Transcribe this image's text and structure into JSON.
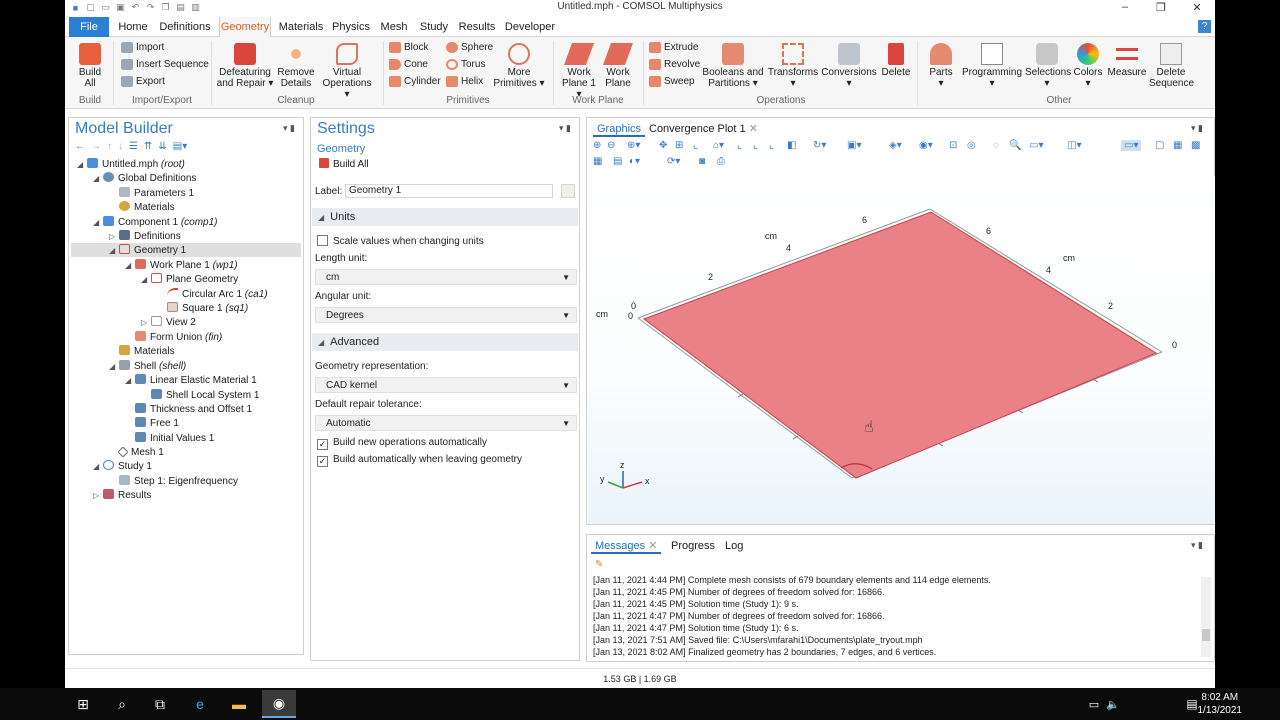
{
  "window": {
    "title": "Untitled.mph - COMSOL Multiphysics",
    "controls": [
      "–",
      "❐",
      "✕"
    ]
  },
  "menu_tabs": [
    "File",
    "Home",
    "Definitions",
    "Geometry",
    "Materials",
    "Physics",
    "Mesh",
    "Study",
    "Results",
    "Developer"
  ],
  "ribbon": {
    "build_all": "Build\nAll",
    "build_group": "Build",
    "import": "Import",
    "insert_sequence": "Insert Sequence",
    "export": "Export",
    "import_export_group": "Import/Export",
    "defeaturing": "Defeaturing\nand Repair ▾",
    "remove_details": "Remove\nDetails",
    "virtual_ops": "Virtual\nOperations ▾",
    "cleanup_group": "Cleanup",
    "block": "Block",
    "cone": "Cone",
    "cylinder": "Cylinder",
    "sphere": "Sphere",
    "torus": "Torus",
    "helix": "Helix",
    "more_primitives": "More\nPrimitives ▾",
    "primitives_group": "Primitives",
    "work_plane": "Work\nPlane 1 ▾",
    "work_plane2": "Work\nPlane",
    "work_plane_group": "Work Plane",
    "extrude": "Extrude",
    "revolve": "Revolve",
    "sweep": "Sweep",
    "booleans": "Booleans and\nPartitions ▾",
    "transforms": "Transforms\n▾",
    "conversions": "Conversions\n▾",
    "delete": "Delete",
    "operations_group": "Operations",
    "parts": "Parts\n▾",
    "programming": "Programming\n▾",
    "selections": "Selections\n▾",
    "colors": "Colors\n▾",
    "measure": "Measure",
    "delete_sequence": "Delete\nSequence",
    "other_group": "Other"
  },
  "model_builder": {
    "title": "Model Builder",
    "tree": [
      {
        "label": "Untitled.mph",
        "tag": "(root)"
      },
      {
        "label": "Global Definitions",
        "tag": ""
      },
      {
        "label": "Parameters 1",
        "tag": ""
      },
      {
        "label": "Materials",
        "tag": ""
      },
      {
        "label": "Component 1",
        "tag": "(comp1)"
      },
      {
        "label": "Definitions",
        "tag": ""
      },
      {
        "label": "Geometry 1",
        "tag": ""
      },
      {
        "label": "Work Plane 1",
        "tag": "(wp1)"
      },
      {
        "label": "Plane Geometry",
        "tag": ""
      },
      {
        "label": "Circular Arc 1",
        "tag": "(ca1)"
      },
      {
        "label": "Square 1",
        "tag": "(sq1)"
      },
      {
        "label": "View 2",
        "tag": ""
      },
      {
        "label": "Form Union",
        "tag": "(fin)"
      },
      {
        "label": "Materials",
        "tag": ""
      },
      {
        "label": "Shell",
        "tag": "(shell)"
      },
      {
        "label": "Linear Elastic Material 1",
        "tag": ""
      },
      {
        "label": "Shell Local System 1",
        "tag": ""
      },
      {
        "label": "Thickness and Offset 1",
        "tag": ""
      },
      {
        "label": "Free 1",
        "tag": ""
      },
      {
        "label": "Initial Values 1",
        "tag": ""
      },
      {
        "label": "Mesh 1",
        "tag": ""
      },
      {
        "label": "Study 1",
        "tag": ""
      },
      {
        "label": "Step 1: Eigenfrequency",
        "tag": ""
      },
      {
        "label": "Results",
        "tag": ""
      }
    ]
  },
  "settings": {
    "title": "Settings",
    "subtitle": "Geometry",
    "build_all": "Build All",
    "label_caption": "Label:",
    "label_value": "Geometry 1",
    "units_section": "Units",
    "scale_values": "Scale values when changing units",
    "length_unit_caption": "Length unit:",
    "length_unit": "cm",
    "angular_unit_caption": "Angular unit:",
    "angular_unit": "Degrees",
    "advanced_section": "Advanced",
    "geom_rep_caption": "Geometry representation:",
    "geom_rep": "CAD kernel",
    "repair_tol_caption": "Default repair tolerance:",
    "repair_tol": "Automatic",
    "build_new_ops": "Build new operations automatically",
    "build_leaving": "Build automatically when leaving geometry"
  },
  "graphics": {
    "tab_graphics": "Graphics",
    "tab_convergence": "Convergence Plot 1",
    "axis_ticks_back_left": [
      "0",
      "2",
      "4",
      "6"
    ],
    "axis_ticks_back_right": [
      "6",
      "4",
      "2",
      "0"
    ],
    "unit_label": "cm",
    "triad": {
      "z": "z",
      "y": "y",
      "x": "x"
    },
    "plate_color": "#e98186"
  },
  "messages": {
    "tabs": [
      "Messages",
      "Progress",
      "Log"
    ],
    "lines": [
      "[Jan 11, 2021 4:44 PM] Complete mesh consists of 679 boundary elements and 114 edge elements.",
      "[Jan 11, 2021 4:45 PM] Number of degrees of freedom solved for: 16866.",
      "[Jan 11, 2021 4:45 PM] Solution time (Study 1): 9 s.",
      "[Jan 11, 2021 4:47 PM] Number of degrees of freedom solved for: 16866.",
      "[Jan 11, 2021 4:47 PM] Solution time (Study 1): 6 s.",
      "[Jan 13, 2021 7:51 AM] Saved file: C:\\Users\\mfarahi1\\Documents\\plate_tryout.mph",
      "[Jan 13, 2021 8:02 AM] Finalized geometry has 2 boundaries, 7 edges, and 6 vertices."
    ]
  },
  "status_bar": "1.53 GB | 1.69 GB",
  "taskbar": {
    "time": "8:02 AM",
    "date": "1/13/2021"
  }
}
